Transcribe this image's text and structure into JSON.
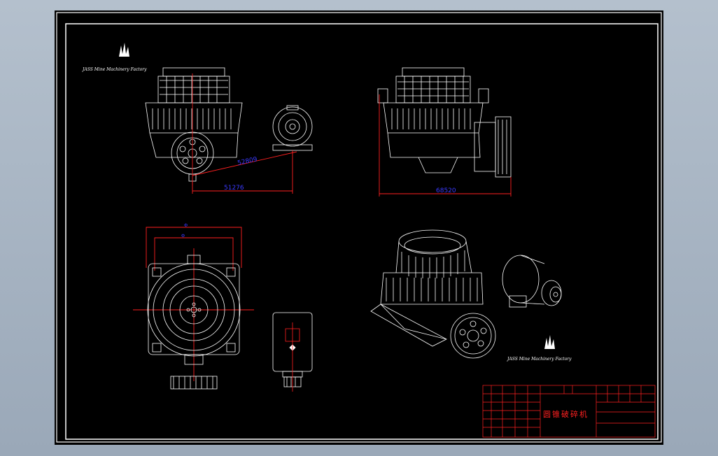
{
  "drawing": {
    "logo_caption": "JASS Mine Machinery Factory",
    "dimensions": {
      "front_diagonal": "52809",
      "front_width": "51276",
      "side_width": "68520",
      "plan_outer": "Ф",
      "plan_inner": "Ф"
    },
    "title_block": {
      "title": "圆锥破碎机"
    }
  },
  "colors": {
    "sheet_bg": "#000000",
    "line_white": "#ffffff",
    "dim_red": "#ff2020",
    "dim_text_blue": "#3a3aff"
  }
}
